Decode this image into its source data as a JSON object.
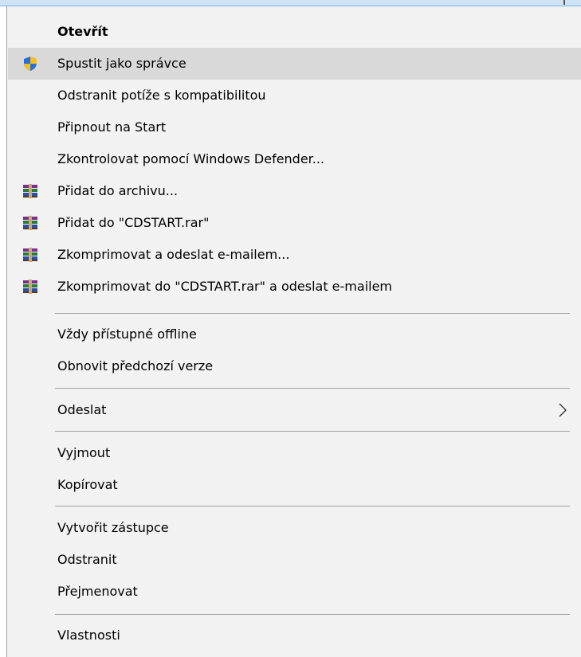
{
  "menu": {
    "items": [
      {
        "label": "Otevřít"
      },
      {
        "label": "Spustit jako správce",
        "icon": "uac-shield-icon"
      },
      {
        "label": "Odstranit potíže s kompatibilitou"
      },
      {
        "label": "Připnout na Start"
      },
      {
        "label": "Zkontrolovat pomocí Windows Defender..."
      },
      {
        "label": "Přidat do archivu...",
        "icon": "winrar-icon"
      },
      {
        "label": "Přidat do \"CDSTART.rar\"",
        "icon": "winrar-icon"
      },
      {
        "label": "Zkomprimovat a odeslat e-mailem...",
        "icon": "winrar-icon"
      },
      {
        "label": "Zkomprimovat do \"CDSTART.rar\" a odeslat e-mailem",
        "icon": "winrar-icon"
      },
      {
        "label": "Vždy přístupné offline"
      },
      {
        "label": "Obnovit předchozí verze"
      },
      {
        "label": "Odeslat",
        "submenu": "chevron-right-icon"
      },
      {
        "label": "Vyjmout"
      },
      {
        "label": "Kopírovat"
      },
      {
        "label": "Vytvořit zástupce"
      },
      {
        "label": "Odstranit"
      },
      {
        "label": "Přejmenovat"
      },
      {
        "label": "Vlastnosti"
      }
    ]
  },
  "colors": {
    "menu_background": "#f2f2f2",
    "highlight": "#d9d9d9",
    "separator": "#a0a0a0",
    "shield_blue": "#2a6fd6",
    "shield_yellow": "#f4c01e"
  }
}
